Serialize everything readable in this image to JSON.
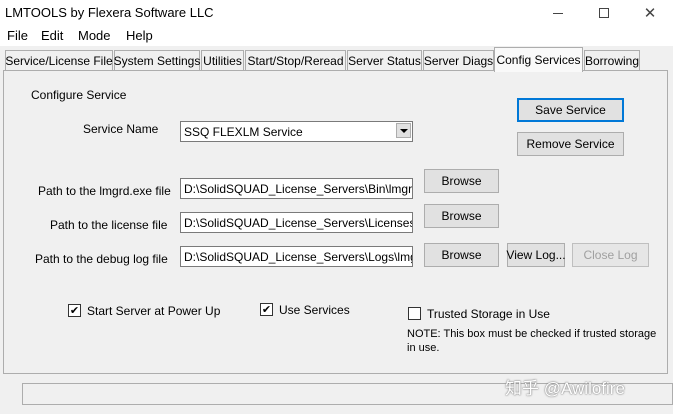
{
  "window": {
    "title": "LMTOOLS by Flexera Software LLC"
  },
  "menu": {
    "file": "File",
    "edit": "Edit",
    "mode": "Mode",
    "help": "Help"
  },
  "tabs": [
    {
      "label": "Service/License File"
    },
    {
      "label": "System Settings"
    },
    {
      "label": "Utilities"
    },
    {
      "label": "Start/Stop/Reread"
    },
    {
      "label": "Server Status"
    },
    {
      "label": "Server Diags"
    },
    {
      "label": "Config Services",
      "active": true
    },
    {
      "label": "Borrowing"
    }
  ],
  "config": {
    "section_title": "Configure Service",
    "service_name_label": "Service Name",
    "service_name_value": "SSQ FLEXLM Service",
    "save_button": "Save Service",
    "remove_button": "Remove Service",
    "lmgrd_label": "Path to the lmgrd.exe file",
    "lmgrd_value": "D:\\SolidSQUAD_License_Servers\\Bin\\lmgrd.exe",
    "license_label": "Path to the license file",
    "license_value": "D:\\SolidSQUAD_License_Servers\\Licenses\\lmgrd",
    "debug_label": "Path to the debug log file",
    "debug_value": "D:\\SolidSQUAD_License_Servers\\Logs\\lmgrd.log",
    "browse_label": "Browse",
    "view_log_label": "View Log...",
    "close_log_label": "Close Log",
    "start_power_up_label": "Start Server at Power Up",
    "start_power_up_checked": true,
    "use_services_label": "Use Services",
    "use_services_checked": true,
    "trusted_storage_label": "Trusted Storage in Use",
    "trusted_storage_checked": false,
    "trusted_note": "NOTE: This box must be checked if trusted storage in use."
  },
  "watermark": "知乎 @Awilofire",
  "icons": {
    "minimize": "minimize-icon",
    "maximize": "maximize-icon",
    "close": "close-icon",
    "checkmark": "checkmark-icon",
    "dropdown": "chevron-down-icon"
  }
}
